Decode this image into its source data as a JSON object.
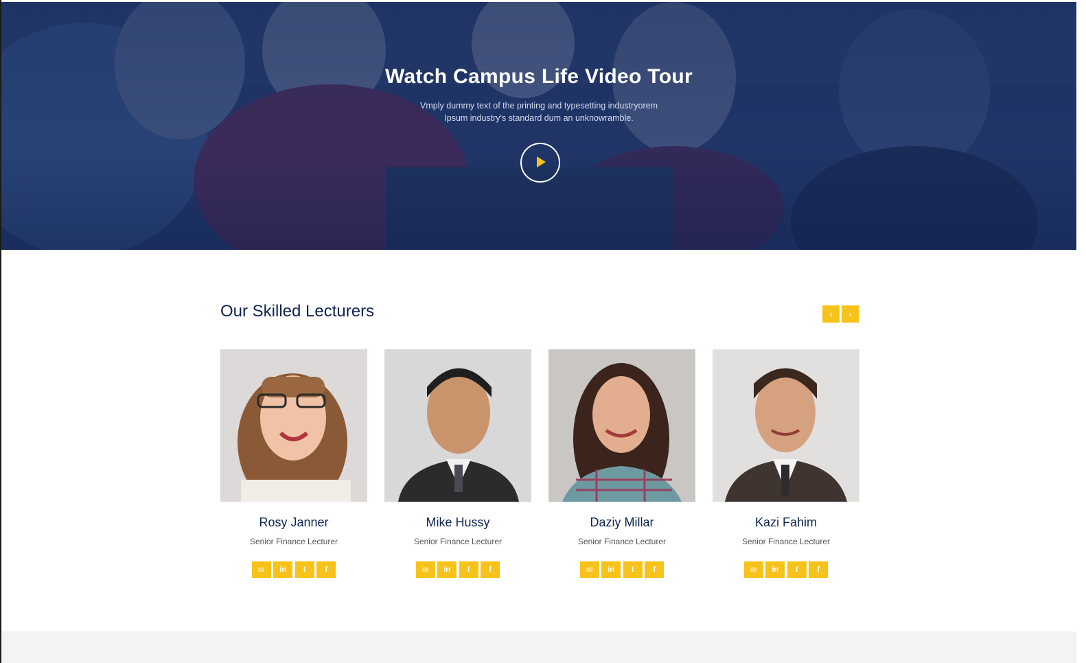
{
  "hero": {
    "title": "Watch Campus Life Video Tour",
    "subtitle_line1": "Vmply dummy text of the printing and typesetting industryorem",
    "subtitle_line2": "Ipsum industry's standard dum an unknowramble.",
    "play_icon": "play-icon"
  },
  "lecturers": {
    "title": "Our Skilled Lecturers",
    "prev_icon": "chevron-left-icon",
    "next_icon": "chevron-right-icon",
    "prev_glyph": "‹",
    "next_glyph": "›",
    "items": [
      {
        "name": "Rosy Janner",
        "role": "Senior Finance Lecturer"
      },
      {
        "name": "Mike Hussy",
        "role": "Senior Finance Lecturer"
      },
      {
        "name": "Daziy Millar",
        "role": "Senior Finance Lecturer"
      },
      {
        "name": "Kazi Fahim",
        "role": "Senior Finance Lecturer"
      }
    ],
    "social_icons": [
      {
        "icon": "email-icon",
        "glyph": "✉"
      },
      {
        "icon": "linkedin-icon",
        "glyph": "in"
      },
      {
        "icon": "twitter-icon",
        "glyph": "t"
      },
      {
        "icon": "facebook-icon",
        "glyph": "f"
      }
    ]
  },
  "colors": {
    "accent": "#f7c31a",
    "navy": "#0f2453",
    "hero_overlay": "#1d3364"
  }
}
